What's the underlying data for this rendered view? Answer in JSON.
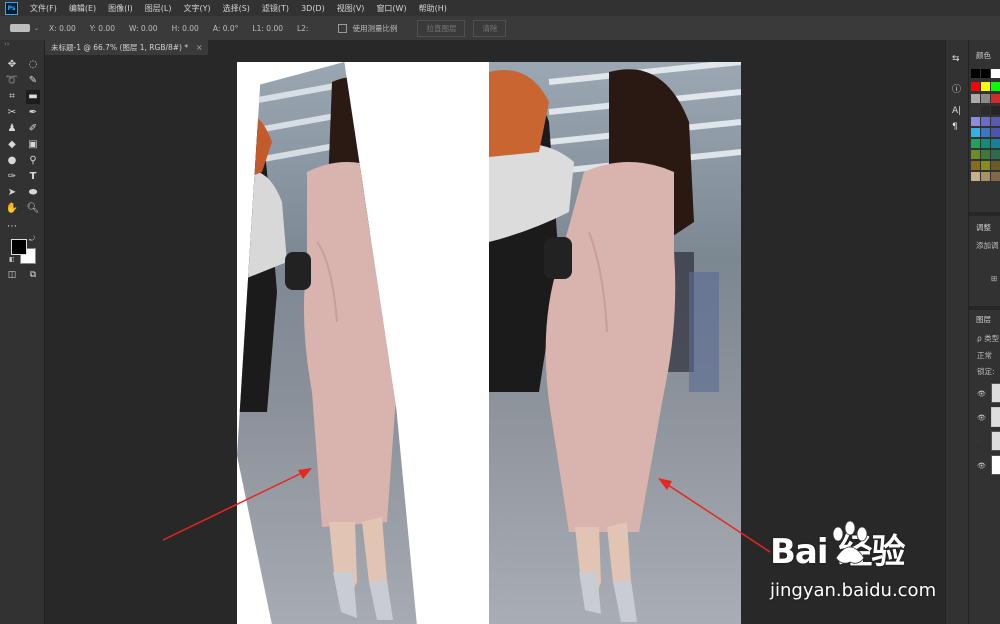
{
  "app": {
    "logo": "Ps",
    "menu": [
      "文件(F)",
      "编辑(E)",
      "图像(I)",
      "图层(L)",
      "文字(Y)",
      "选择(S)",
      "滤镜(T)",
      "3D(D)",
      "视图(V)",
      "窗口(W)",
      "帮助(H)"
    ]
  },
  "options": {
    "x": "X: 0.00",
    "y": "Y: 0.00",
    "w": "W: 0.00",
    "h": "H: 0.00",
    "a": "A: 0.0°",
    "l1": "L1: 0.00",
    "l2": "L2:",
    "use_scale": "使用测量比例",
    "straighten": "拉直图层",
    "clear": "清除"
  },
  "document": {
    "tab_title": "未标题-1 @ 66.7% (图层 1, RGB/8#) *",
    "close": "×"
  },
  "tools": {
    "grip": "››"
  },
  "panels": {
    "color_title": "颜色",
    "adjust_title": "调整",
    "adjust_add": "添加调",
    "layers_title": "图层",
    "layers_filter": "ρ 类型",
    "blend_mode": "正常",
    "lock": "锁定:"
  },
  "watermark": {
    "brand": "Bai  经验",
    "url": "jingyan.baidu.com"
  },
  "colors": {
    "accent": "#31a8ff",
    "arrow": "#e8261e",
    "dress": "#d9b3ae"
  }
}
